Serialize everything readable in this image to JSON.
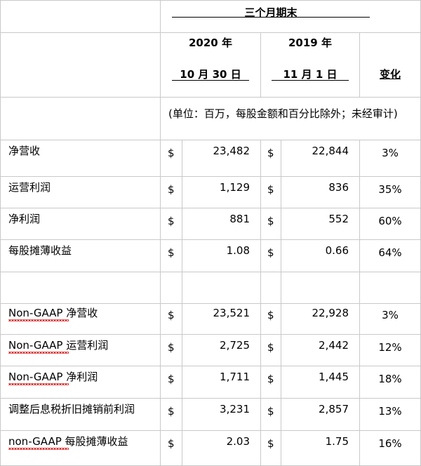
{
  "header": {
    "period_title": "三个月期末",
    "col_2020_year": "2020 年",
    "col_2020_date": "10 月 30 日",
    "col_2019_year": "2019 年",
    "col_2019_date": "11 月 1 日",
    "col_change": "变化"
  },
  "note": "(单位：百万，每股金额和百分比除外；未经审计)",
  "currency_symbol": "$",
  "rows": [
    {
      "label": "净营收",
      "v2020": "23,482",
      "v2019": "22,844",
      "change": "3%"
    },
    {
      "label": "运营利润",
      "v2020": "1,129",
      "v2019": "836",
      "change": "35%"
    },
    {
      "label": "净利润",
      "v2020": "881",
      "v2019": "552",
      "change": "60%"
    },
    {
      "label": "每股摊薄收益",
      "v2020": "1.08",
      "v2019": "0.66",
      "change": "64%"
    },
    {
      "label": "Non-GAAP 净营收",
      "v2020": "23,521",
      "v2019": "22,928",
      "change": "3%"
    },
    {
      "label": "Non-GAAP 运营利润",
      "v2020": "2,725",
      "v2019": "2,442",
      "change": "12%"
    },
    {
      "label": "Non-GAAP 净利润",
      "v2020": "1,711",
      "v2019": "1,445",
      "change": "18%"
    },
    {
      "label": "调整后息税折旧摊销前利润",
      "v2020": "3,231",
      "v2019": "2,857",
      "change": "13%"
    },
    {
      "label": "non-GAAP 每股摊薄收益",
      "v2020": "2.03",
      "v2019": "1.75",
      "change": "16%"
    }
  ]
}
